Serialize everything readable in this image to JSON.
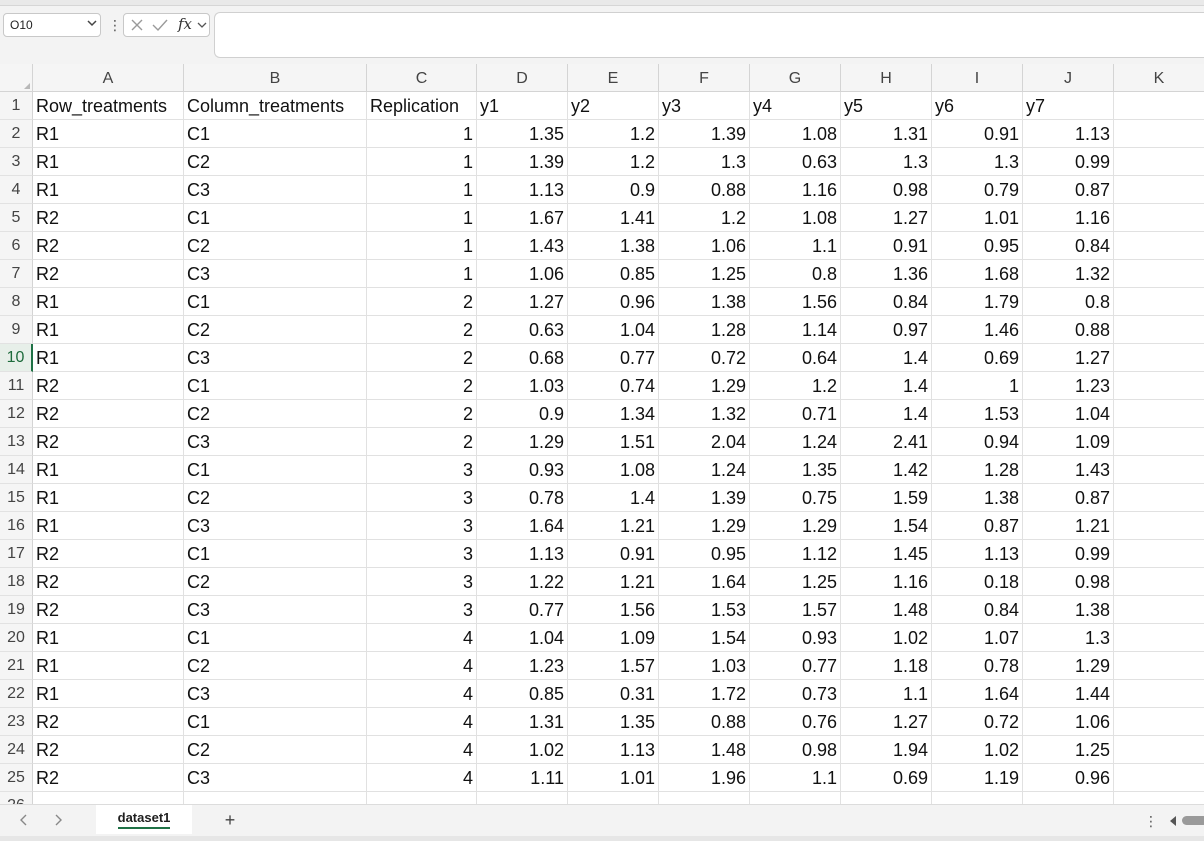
{
  "formula_bar": {
    "name_box_value": "O10",
    "fx_label": "fx",
    "formula_value": ""
  },
  "columns": [
    {
      "letter": "A",
      "w": 151
    },
    {
      "letter": "B",
      "w": 183
    },
    {
      "letter": "C",
      "w": 110
    },
    {
      "letter": "D",
      "w": 91
    },
    {
      "letter": "E",
      "w": 91
    },
    {
      "letter": "F",
      "w": 91
    },
    {
      "letter": "G",
      "w": 91
    },
    {
      "letter": "H",
      "w": 91
    },
    {
      "letter": "I",
      "w": 91
    },
    {
      "letter": "J",
      "w": 91
    },
    {
      "letter": "K",
      "w": 91
    }
  ],
  "header_row": [
    "Row_treatments",
    "Column_treatments",
    "Replication",
    "y1",
    "y2",
    "y3",
    "y4",
    "y5",
    "y6",
    "y7"
  ],
  "rows": [
    [
      "R1",
      "C1",
      "1",
      "1.35",
      "1.2",
      "1.39",
      "1.08",
      "1.31",
      "0.91",
      "1.13"
    ],
    [
      "R1",
      "C2",
      "1",
      "1.39",
      "1.2",
      "1.3",
      "0.63",
      "1.3",
      "1.3",
      "0.99"
    ],
    [
      "R1",
      "C3",
      "1",
      "1.13",
      "0.9",
      "0.88",
      "1.16",
      "0.98",
      "0.79",
      "0.87"
    ],
    [
      "R2",
      "C1",
      "1",
      "1.67",
      "1.41",
      "1.2",
      "1.08",
      "1.27",
      "1.01",
      "1.16"
    ],
    [
      "R2",
      "C2",
      "1",
      "1.43",
      "1.38",
      "1.06",
      "1.1",
      "0.91",
      "0.95",
      "0.84"
    ],
    [
      "R2",
      "C3",
      "1",
      "1.06",
      "0.85",
      "1.25",
      "0.8",
      "1.36",
      "1.68",
      "1.32"
    ],
    [
      "R1",
      "C1",
      "2",
      "1.27",
      "0.96",
      "1.38",
      "1.56",
      "0.84",
      "1.79",
      "0.8"
    ],
    [
      "R1",
      "C2",
      "2",
      "0.63",
      "1.04",
      "1.28",
      "1.14",
      "0.97",
      "1.46",
      "0.88"
    ],
    [
      "R1",
      "C3",
      "2",
      "0.68",
      "0.77",
      "0.72",
      "0.64",
      "1.4",
      "0.69",
      "1.27"
    ],
    [
      "R2",
      "C1",
      "2",
      "1.03",
      "0.74",
      "1.29",
      "1.2",
      "1.4",
      "1",
      "1.23"
    ],
    [
      "R2",
      "C2",
      "2",
      "0.9",
      "1.34",
      "1.32",
      "0.71",
      "1.4",
      "1.53",
      "1.04"
    ],
    [
      "R2",
      "C3",
      "2",
      "1.29",
      "1.51",
      "2.04",
      "1.24",
      "2.41",
      "0.94",
      "1.09"
    ],
    [
      "R1",
      "C1",
      "3",
      "0.93",
      "1.08",
      "1.24",
      "1.35",
      "1.42",
      "1.28",
      "1.43"
    ],
    [
      "R1",
      "C2",
      "3",
      "0.78",
      "1.4",
      "1.39",
      "0.75",
      "1.59",
      "1.38",
      "0.87"
    ],
    [
      "R1",
      "C3",
      "3",
      "1.64",
      "1.21",
      "1.29",
      "1.29",
      "1.54",
      "0.87",
      "1.21"
    ],
    [
      "R2",
      "C1",
      "3",
      "1.13",
      "0.91",
      "0.95",
      "1.12",
      "1.45",
      "1.13",
      "0.99"
    ],
    [
      "R2",
      "C2",
      "3",
      "1.22",
      "1.21",
      "1.64",
      "1.25",
      "1.16",
      "0.18",
      "0.98"
    ],
    [
      "R2",
      "C3",
      "3",
      "0.77",
      "1.56",
      "1.53",
      "1.57",
      "1.48",
      "0.84",
      "1.38"
    ],
    [
      "R1",
      "C1",
      "4",
      "1.04",
      "1.09",
      "1.54",
      "0.93",
      "1.02",
      "1.07",
      "1.3"
    ],
    [
      "R1",
      "C2",
      "4",
      "1.23",
      "1.57",
      "1.03",
      "0.77",
      "1.18",
      "0.78",
      "1.29"
    ],
    [
      "R1",
      "C3",
      "4",
      "0.85",
      "0.31",
      "1.72",
      "0.73",
      "1.1",
      "1.64",
      "1.44"
    ],
    [
      "R2",
      "C1",
      "4",
      "1.31",
      "1.35",
      "0.88",
      "0.76",
      "1.27",
      "0.72",
      "1.06"
    ],
    [
      "R2",
      "C2",
      "4",
      "1.02",
      "1.13",
      "1.48",
      "0.98",
      "1.94",
      "1.02",
      "1.25"
    ],
    [
      "R2",
      "C3",
      "4",
      "1.11",
      "1.01",
      "1.96",
      "1.1",
      "0.69",
      "1.19",
      "0.96"
    ]
  ],
  "active_row": 10,
  "sheet_tabs": [
    {
      "label": "dataset1",
      "active": true
    }
  ],
  "add_sheet_label": "+",
  "theme": {
    "accent": "#1e7145"
  }
}
